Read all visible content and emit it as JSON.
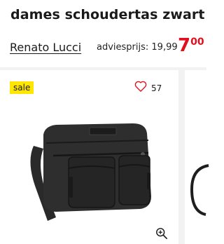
{
  "product": {
    "title": "dames schoudertas zwart",
    "brand": "Renato Lucci",
    "advice_price_label": "adviesprijs: 19,99",
    "price_euros": "7",
    "price_cents": "00",
    "price_color": "#e0101e"
  },
  "card": {
    "badge": "sale",
    "badge_color": "#ffe600",
    "favorite_icon": "heart-outline-icon",
    "favorite_count": "57",
    "zoom_icon": "magnifier-plus-icon"
  }
}
